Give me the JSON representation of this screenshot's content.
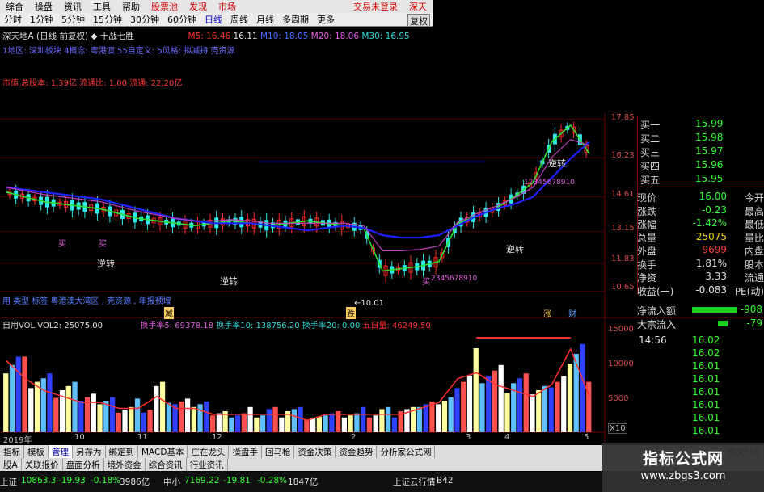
{
  "menu": {
    "items": [
      "综合",
      "操盘",
      "资讯",
      "工具",
      "帮助",
      "股票池",
      "发现",
      "市场"
    ],
    "right_text": "交易未登录",
    "right_text2": "深天"
  },
  "period_bar": {
    "items": [
      "分时",
      "1分钟",
      "5分钟",
      "15分钟",
      "30分钟",
      "60分钟",
      "日线",
      "周线",
      "月线",
      "多周期",
      "更多"
    ],
    "active": "日线",
    "fq_button": "复权"
  },
  "stock": {
    "name": "深天地A",
    "mode": "(日线 前复权)",
    "indicator": "十战七胜",
    "ma5": "M5: 16.46",
    "ma10": "M10: 18.05",
    "ma20": "M20: 18.06",
    "ma30": "M30: 16.95",
    "price_mark": "16.11"
  },
  "tagline": "1地区: 深圳板块  4概念: 粤港澳  55自定义: 5风格: 拟减持 壳资源",
  "capline": "市值  总股本: 1.39亿  流通比: 1.00  流通: 22.20亿",
  "price_axis": [
    "17.85",
    "16.23",
    "14.61",
    "13.15",
    "11.83",
    "10.65"
  ],
  "annotations": {
    "low_mark": "←10.01",
    "notes_bottom": "用 类型 标签  粤港澳大湾区 , 壳资源 , 年报预增",
    "char_jian": "减",
    "char_die": "跌",
    "char_zhang": "涨",
    "char_cai": "财",
    "signal_nizhuan": "逆转",
    "signal_mai": "买",
    "sequence_text": "12345678910",
    "sequence_text2": "2345678910"
  },
  "volume_panel": {
    "title": "自用VOL VOL2: 25075.00",
    "huanshou5": "换手率5: 69378.18",
    "huanshou10": "换手率10: 138756.20",
    "huanshou20": "换手率20: 0.00",
    "wuri": "五日量: 46249.50",
    "scale": [
      "15000",
      "10000",
      "5000"
    ],
    "unit": "X10"
  },
  "date_axis": [
    "2019年",
    "10",
    "11",
    "12",
    "2",
    "3",
    "4",
    "5"
  ],
  "order_book": [
    {
      "label": "买一",
      "price": "15.99"
    },
    {
      "label": "买二",
      "price": "15.98"
    },
    {
      "label": "买三",
      "price": "15.97"
    },
    {
      "label": "买四",
      "price": "15.96"
    },
    {
      "label": "买五",
      "price": "15.95"
    }
  ],
  "quote": [
    {
      "label": "现价",
      "value": "16.00",
      "label2": "今开",
      "color": "#30ff30"
    },
    {
      "label": "涨跌",
      "value": "-0.23",
      "label2": "最高",
      "color": "#30ff30"
    },
    {
      "label": "涨幅",
      "value": "-1.42%",
      "label2": "最低",
      "color": "#30ff30"
    },
    {
      "label": "总量",
      "value": "25075",
      "label2": "量比",
      "color": "#e8d200"
    },
    {
      "label": "外盘",
      "value": "9699",
      "label2": "内盘",
      "color": "#ff4040"
    },
    {
      "label": "换手",
      "value": "1.81%",
      "label2": "股本",
      "color": "#e0e0e0"
    },
    {
      "label": "净资",
      "value": "3.33",
      "label2": "流通",
      "color": "#e0e0e0"
    },
    {
      "label": "收益(一)",
      "value": "-0.083",
      "label2": "PE(动)",
      "color": "#e0e0e0"
    }
  ],
  "flow": {
    "in_label": "净流入额",
    "in_value": "-908",
    "big_label": "大宗流入",
    "big_value": "-79"
  },
  "ticks": {
    "time": "14:56",
    "prices": [
      "16.02",
      "16.02",
      "16.01",
      "16.01",
      "16.01",
      "16.01",
      "16.01",
      "16.01"
    ]
  },
  "tabs1": [
    "指标",
    "模板",
    "管理",
    "另存为",
    "绑定到",
    "MACD基本",
    "庄在龙头",
    "操盘手",
    "回马枪",
    "资金决策",
    "资金趋势",
    "分析家公式网"
  ],
  "tabs1_active": "管理",
  "tabs1_right": "图文F10",
  "tabs2": [
    "股A",
    "关联报价",
    "盘面分析",
    "境外资金",
    "综合资讯",
    "行业资讯"
  ],
  "status": {
    "sh_label": "上证",
    "sh_value": "10863.3",
    "sh_chg": "-19.93",
    "sh_pct": "-0.18%",
    "sh_amt": "3986亿",
    "zx_label": "中小",
    "zx_value": "7169.22",
    "zx_chg": "-19.81",
    "zx_pct": "-0.28%",
    "zx_amt": "1847亿",
    "news": "上证云行情",
    "tail": "B42"
  },
  "watermark": {
    "line1": "指标公式网",
    "line2": "www.zbgs3.com"
  },
  "chart_data": {
    "type": "line",
    "title": "",
    "xlabel": "",
    "ylabel": "",
    "ylim": [
      10.0,
      18.0
    ],
    "x_ticks": [
      "2019年",
      "10",
      "11",
      "12",
      "2",
      "3",
      "4",
      "5"
    ],
    "y_ticks": [
      17.85,
      16.23,
      14.61,
      13.15,
      11.83,
      10.65
    ],
    "series": [
      {
        "name": "M5",
        "values": [
          14.8,
          14.6,
          14.4,
          14.3,
          14.2,
          14.1,
          13.9,
          13.7,
          13.6,
          13.5,
          13.4,
          13.5,
          13.6,
          13.5,
          13.4,
          13.5,
          13.6,
          13.5,
          13.4,
          13.3,
          11.5,
          11.6,
          11.7,
          11.9,
          13.5,
          13.8,
          14.1,
          14.6,
          15.2,
          16.9,
          17.6,
          16.4
        ]
      },
      {
        "name": "M30",
        "values": [
          15.0,
          14.9,
          14.8,
          14.7,
          14.6,
          14.5,
          14.3,
          14.1,
          13.9,
          13.7,
          13.6,
          13.5,
          13.5,
          13.5,
          13.4,
          13.3,
          13.2,
          13.3,
          13.4,
          13.3,
          13.0,
          12.9,
          12.9,
          13.0,
          13.4,
          13.8,
          14.1,
          14.3,
          14.6,
          15.4,
          16.2,
          16.9
        ]
      }
    ],
    "volume": [
      12,
      9,
      7,
      6,
      5,
      5,
      4,
      4,
      6,
      4,
      4,
      3,
      3,
      3,
      3,
      3,
      2,
      3,
      3,
      3,
      3,
      3,
      4,
      5,
      9,
      10,
      8,
      7,
      6,
      8,
      14,
      6
    ]
  }
}
